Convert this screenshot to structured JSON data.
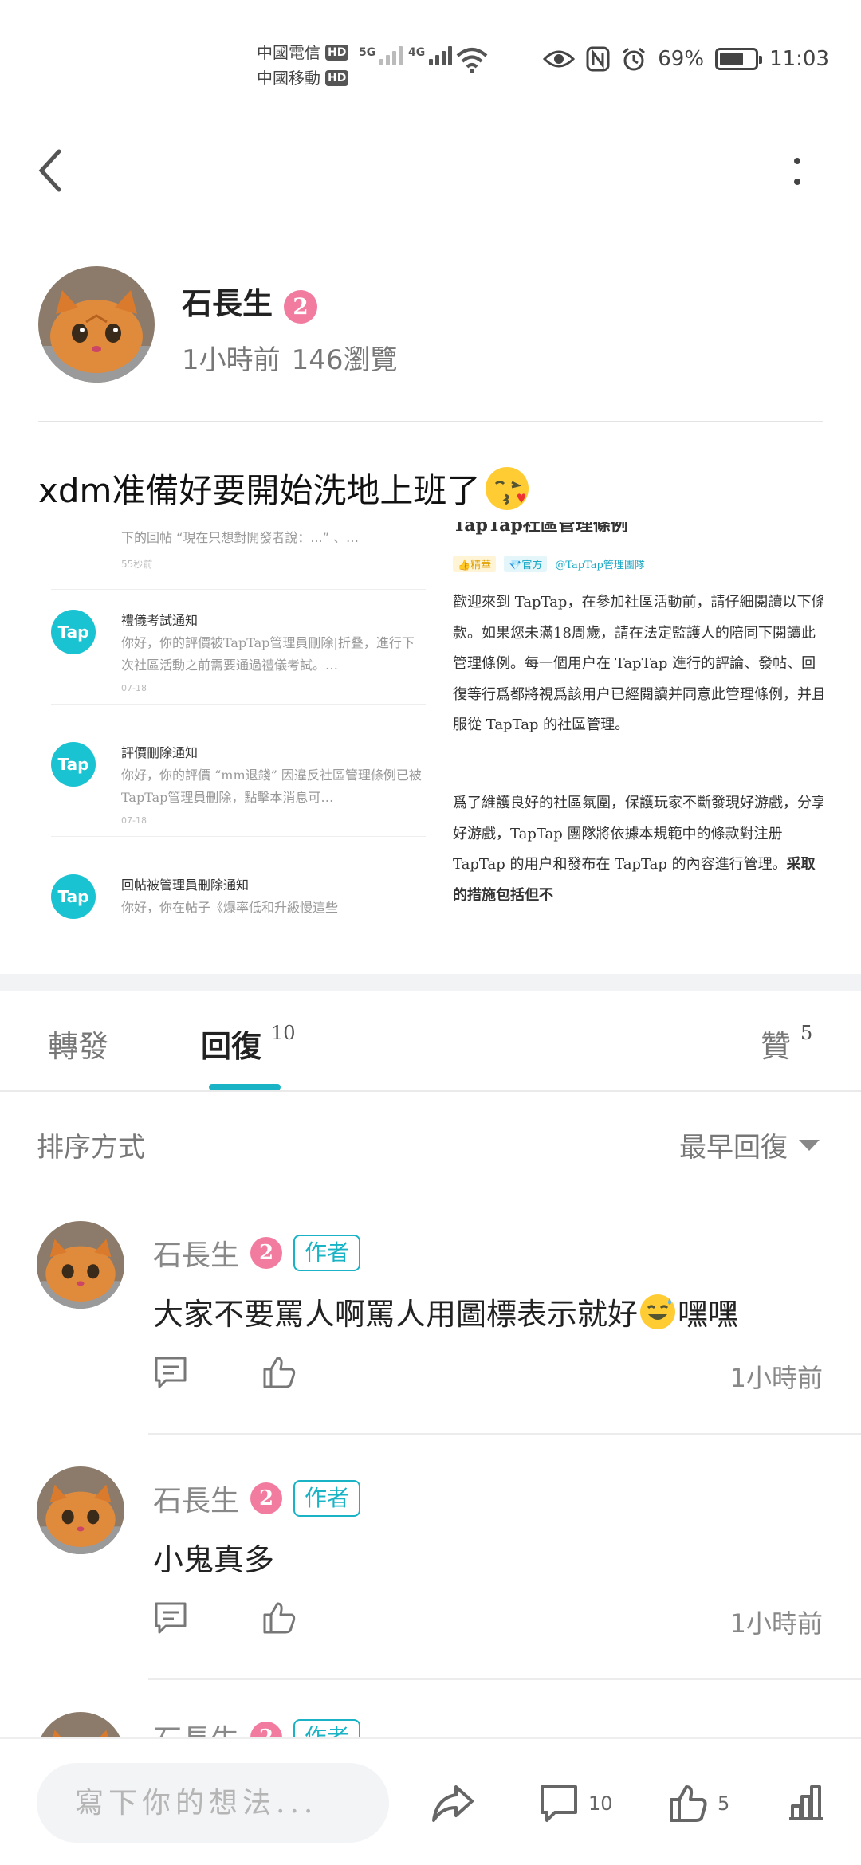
{
  "status_bar": {
    "carrier1": "中國電信",
    "carrier2": "中國移動",
    "hd_label": "HD",
    "net1": "5G",
    "net2": "4G",
    "battery_percent": "69%",
    "battery_level": 0.69,
    "time": "11:03"
  },
  "author": {
    "name": "石長生",
    "level": "2",
    "time_ago": "1小時前",
    "views": "146瀏覽"
  },
  "post": {
    "title": "xdm准備好要開始洗地上班了"
  },
  "screenshot_left": {
    "cut_text": "下的回帖 “現在只想對開發者說：...” 、…",
    "cut_time": "55秒前",
    "notices": [
      {
        "logo": "Tap",
        "title": "禮儀考試通知",
        "body": "你好，你的評價被TapTap管理員刪除|折叠，進行下次社區活動之前需要通過禮儀考試。…",
        "date": "07-18"
      },
      {
        "logo": "Tap",
        "title": "評價刪除通知",
        "body": "你好，你的評價 “mm退錢” 因違反社區管理條例已被TapTap管理員刪除，點擊本消息可…",
        "date": "07-18"
      },
      {
        "logo": "Tap",
        "title": "回帖被管理員刪除通知",
        "body": "你好，你在帖子《爆率低和升級慢這些",
        "date": ""
      }
    ]
  },
  "screenshot_right": {
    "title": "TapTap社區管理條例",
    "tag1": "👍精華",
    "tag2": "💎官方",
    "tag_link": "@TapTap管理團隊",
    "para1": "歡迎來到 TapTap，在參加社區活動前，請仔細閱讀以下條款。如果您未滿18周歲，請在法定監護人的陪同下閱讀此管理條例。每一個用户在 TapTap 進行的評論、發帖、回復等行爲都將視爲該用户已經閱讀并同意此管理條例，并且服從 TapTap 的社區管理。",
    "para2": "爲了維護良好的社區氛圍，保護玩家不斷發現好游戲，分享好游戲，TapTap 團隊將依據本規範中的條款對注册 TapTap 的用户和發布在 TapTap 的內容進行管理。",
    "para2_bold": "采取的措施包括但不"
  },
  "tabs": {
    "repost": "轉發",
    "reply": "回復",
    "reply_count": "10",
    "like": "贊",
    "like_count": "5"
  },
  "sort": {
    "label": "排序方式",
    "value": "最早回復"
  },
  "replies": [
    {
      "name": "石長生",
      "level": "2",
      "tag": "作者",
      "text": "大家不要罵人啊罵人用圖標表示就好",
      "text_after": "嘿嘿",
      "time": "1小時前"
    },
    {
      "name": "石長生",
      "level": "2",
      "tag": "作者",
      "text": "小鬼真多",
      "text_after": "",
      "time": "1小時前"
    },
    {
      "name": "石長生",
      "level": "2",
      "tag": "作者",
      "text": "",
      "text_after": "",
      "time": ""
    }
  ],
  "bottom_bar": {
    "placeholder": "寫下你的想法...",
    "comment_count": "10",
    "like_count": "5"
  },
  "colors": {
    "accent": "#19b3c5",
    "level_badge": "#f27ca0",
    "tap_logo": "#19c3d2"
  }
}
